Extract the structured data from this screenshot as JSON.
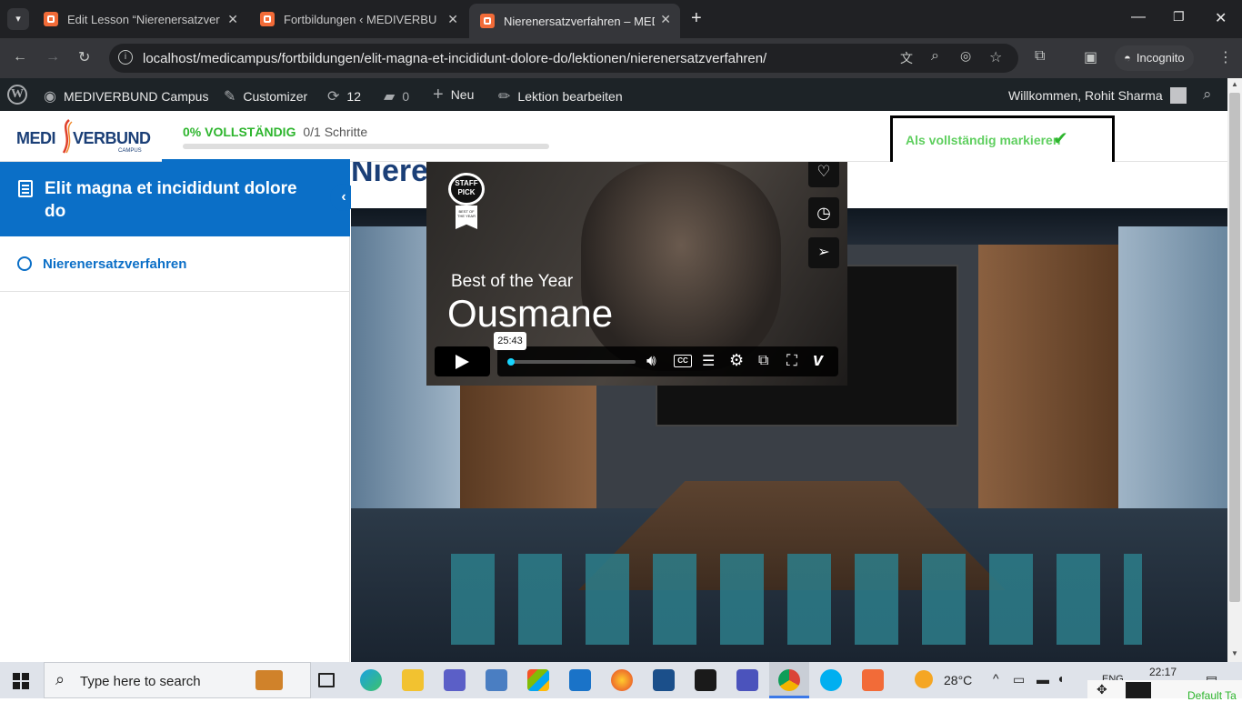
{
  "browser": {
    "tabs": [
      {
        "title": "Edit Lesson “Nierenersatzverfah",
        "active": false
      },
      {
        "title": "Fortbildungen ‹ MEDIVERBUND",
        "active": false
      },
      {
        "title": "Nierenersatzverfahren – MEDIVE",
        "active": true
      }
    ],
    "url": "localhost/medicampus/fortbildungen/elit-magna-et-incididunt-dolore-do/lektionen/nierenersatzverfahren/",
    "profile_label": "Incognito"
  },
  "wp_admin_bar": {
    "site_name": "MEDIVERBUND Campus",
    "customizer": "Customizer",
    "updates_count": "12",
    "comments_count": "0",
    "new_label": "Neu",
    "edit_label": "Lektion bearbeiten",
    "greeting": "Willkommen, Rohit Sharma"
  },
  "header": {
    "logo_text_left": "MEDI",
    "logo_text_right": "VERBUND",
    "logo_sub": "CAMPUS",
    "progress_percent_label": "0% VOLLSTÄNDIG",
    "progress_steps": "0/1 Schritte",
    "progress_fraction": 0,
    "mark_complete_label": "Als vollständig markieren"
  },
  "sidebar": {
    "course_title": "Elit magna et incididunt dolore do",
    "lessons": [
      {
        "title": "Nierenersatzverfahren"
      }
    ]
  },
  "content": {
    "lesson_title_partial": "Niere"
  },
  "video": {
    "badge_line1": "STAFF",
    "badge_line2": "PICK",
    "badge_sub": "BEST OF THE YEAR",
    "subtitle": "Best of the Year",
    "title": "Ousmane",
    "time_tooltip": "25:43",
    "progress_fraction": 0.01
  },
  "taskbar": {
    "search_placeholder": "Type here to search",
    "temperature": "28°C",
    "language": "ENG",
    "time": "22:17",
    "overflow_label": "Default Ta"
  },
  "colors": {
    "accent_blue": "#0b6fc7",
    "green": "#2db52d",
    "wp_bar": "#1d2327",
    "chrome_dark": "#202124"
  }
}
